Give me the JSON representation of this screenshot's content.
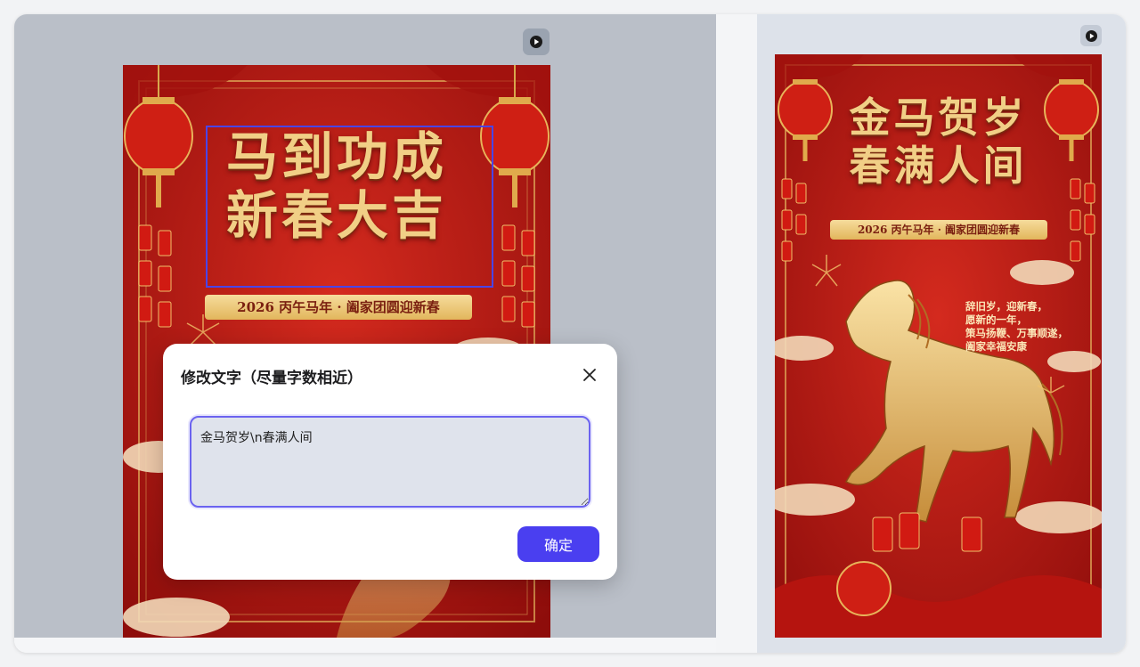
{
  "left_poster": {
    "title_line1": "马到功成",
    "title_line2": "新春大吉",
    "subtitle": "2026  丙午马年 · 阖家团圆迎新春"
  },
  "right_poster": {
    "title_line1": "金马贺岁",
    "title_line2": "春满人间",
    "subtitle": "2026  丙午马年 · 阖家团圆迎新春",
    "blessing": [
      "辞旧岁，迎新春，",
      "愿新的一年，",
      "策马扬鞭、万事顺遂，",
      "阖家幸福安康"
    ]
  },
  "dialog": {
    "title": "修改文字（尽量字数相近）",
    "input_value": "金马贺岁\\n春满人间",
    "confirm_label": "确定"
  },
  "icons": {
    "play": "play-icon",
    "close": "close-icon"
  },
  "colors": {
    "poster_red": "#c41a16",
    "gold": "#f1cf86",
    "accent": "#4a3ff0",
    "selection": "#4a45e8"
  }
}
